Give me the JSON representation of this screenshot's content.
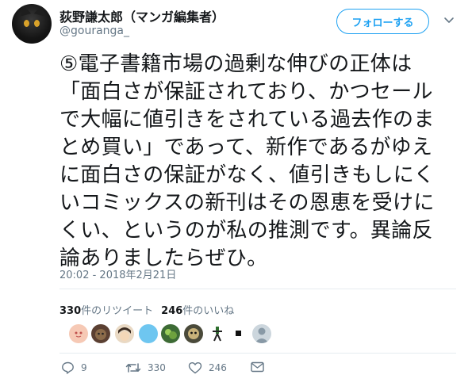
{
  "user": {
    "display_name": "荻野謙太郎（マンガ編集者）",
    "handle": "@gouranga_"
  },
  "follow_button": "フォローする",
  "tweet": {
    "lines": [
      "⑤電子書籍市場の過剰な伸びの正体は",
      "「面白さが保証されており、かつセール",
      "で大幅に値引きをされている過去作のま",
      "とめ買い」であって、新作であるがゆえ",
      "に面白さの保証がなく、値引きもしにく",
      "いコミックスの新刊はその恩恵を受けに",
      "くい、というのが私の推測です。異論反",
      "論ありましたらぜひ。"
    ],
    "timestamp": "20:02 - 2018年2月21日"
  },
  "stats": {
    "retweet_count": "330",
    "retweet_label": "件のリツイート",
    "like_count": "246",
    "like_label": "件のいいね"
  },
  "actions": {
    "reply_count": "9",
    "retweet_count": "330",
    "like_count": "246"
  },
  "colors": {
    "accent": "#1da1f2",
    "secondary_text": "#657786",
    "divider": "#e6ecf0"
  },
  "icons": [
    "chevron-down-icon",
    "reply-icon",
    "retweet-icon",
    "like-icon",
    "share-icon"
  ]
}
